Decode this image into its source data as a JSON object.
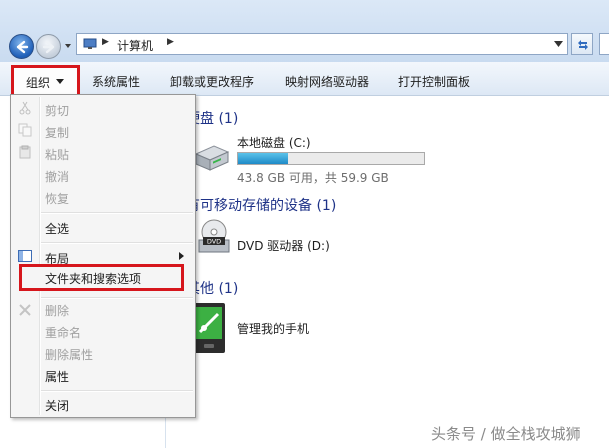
{
  "address": {
    "path_label": "计算机",
    "computer_icon": "computer-icon",
    "back_icon": "back-arrow-icon",
    "forward_icon": "forward-arrow-icon",
    "refresh_icon": "refresh-icon"
  },
  "toolbar": {
    "organize": "组织",
    "system_properties": "系统属性",
    "uninstall": "卸载或更改程序",
    "map_drive": "映射网络驱动器",
    "control_panel": "打开控制面板"
  },
  "groups": {
    "hard_disks": "硬盘 (1)",
    "removable": "有可移动存储的设备 (1)",
    "other": "其他 (1)"
  },
  "drives": {
    "local_name": "本地磁盘 (C:)",
    "local_space": "43.8 GB 可用，共 59.9 GB",
    "local_used_fraction": 0.27,
    "dvd_name": "DVD 驱动器 (D:)",
    "phone_name": "管理我的手机"
  },
  "menu": {
    "cut": "剪切",
    "copy": "复制",
    "paste": "粘贴",
    "undo": "撤消",
    "redo": "恢复",
    "select_all": "全选",
    "layout": "布局",
    "folder_options": "文件夹和搜索选项",
    "delete": "删除",
    "rename": "重命名",
    "remove_props": "删除属性",
    "properties": "属性",
    "close": "关闭"
  },
  "watermark": "头条号 / 做全栈攻城狮",
  "colors": {
    "highlight_box": "#d6161c",
    "group_header": "#1e3287",
    "disk_bar": "#26a0da"
  }
}
